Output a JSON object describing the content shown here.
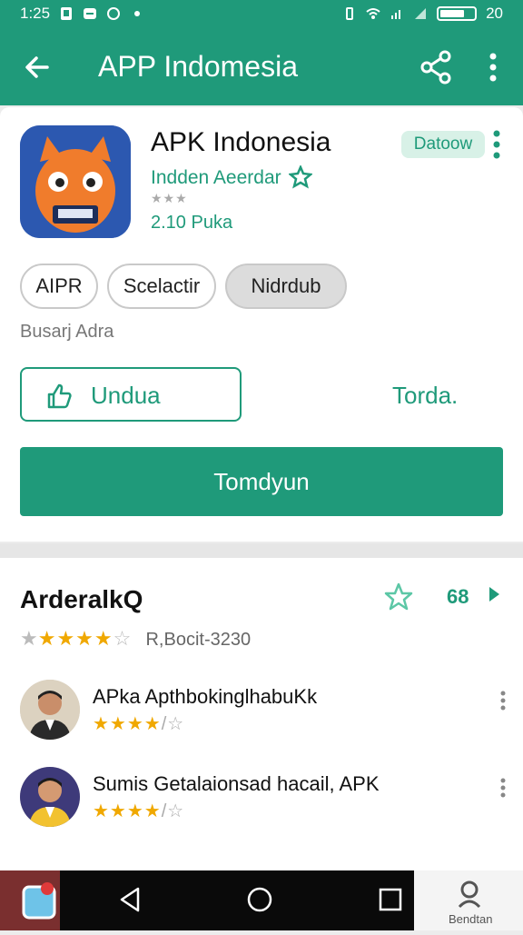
{
  "status_bar": {
    "time": "1:25",
    "battery_text": "20"
  },
  "app_bar": {
    "title": "APP Indomesia"
  },
  "app": {
    "name": "APK Indonesia",
    "developer": "Indden Aeerdar",
    "rating_small": "★★★",
    "price": "2.10 Puka",
    "badge": "Datoow"
  },
  "chips": [
    "AIPR",
    "Scelactir",
    "Nidrdub"
  ],
  "subtitle": "Busarj Adra",
  "install_label": "Undua",
  "text_link": "Torda.",
  "primary_button": "Tomdyun",
  "reviews": {
    "title": "ArderalkQ",
    "count": "68",
    "rating_meta": "R,Bocit-3230",
    "items": [
      {
        "name": "APka ApthbokinglhabuKk"
      },
      {
        "name": "Sumis Getalaionsad hacail, APK"
      }
    ]
  },
  "nav": {
    "right_label": "Bendtan"
  },
  "colors": {
    "accent": "#1f9a7a",
    "star": "#f0a800"
  }
}
